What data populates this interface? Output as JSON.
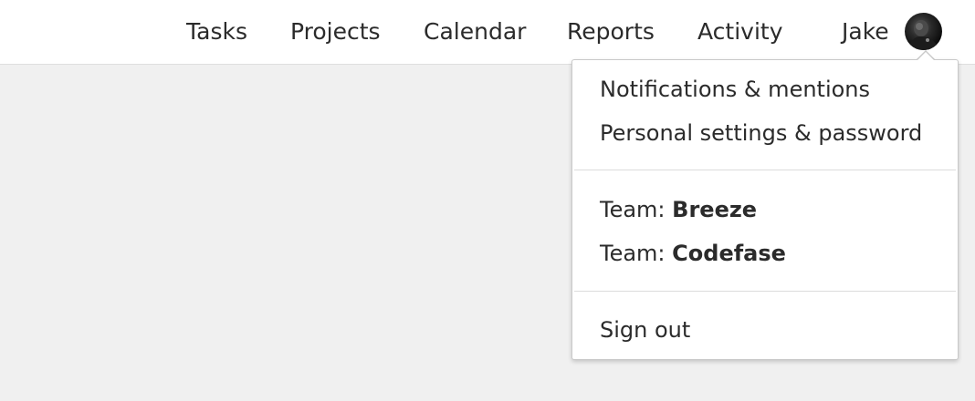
{
  "nav": {
    "tasks": "Tasks",
    "projects": "Projects",
    "calendar": "Calendar",
    "reports": "Reports",
    "activity": "Activity",
    "user_name": "Jake"
  },
  "avatar": {
    "icon": "user-avatar"
  },
  "dropdown": {
    "notifications": "Notifications & mentions",
    "personal_settings": "Personal settings & password",
    "team_prefix": "Team: ",
    "teams": [
      "Breeze",
      "Codefase"
    ],
    "sign_out": "Sign out"
  },
  "colors": {
    "background": "#f0f0f0",
    "topbar": "#ffffff",
    "text": "#2b2b2b",
    "divider": "#dcdcdc"
  }
}
